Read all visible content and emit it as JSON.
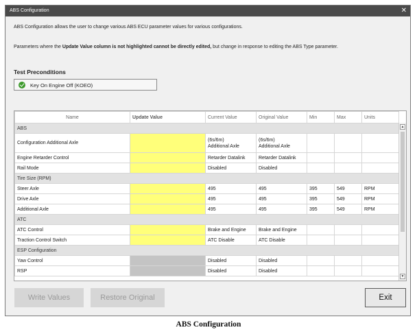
{
  "window": {
    "title": "ABS Configuration",
    "close_glyph": "✕"
  },
  "description": {
    "line1": "ABS Configuration allows the user to change various ABS ECU parameter values for various configurations.",
    "line2_prefix": "Parameters where the ",
    "line2_bold": "Update Value column is not highlighted cannot be directly edited,",
    "line2_suffix": " but change in response to editing the ABS Type parameter."
  },
  "preconditions": {
    "title": "Test Preconditions",
    "item_label": "Key On Engine Off (KOEO)",
    "item_icon": "check-circle-icon",
    "item_status_color": "#3d9a2c"
  },
  "table": {
    "headers": [
      "Name",
      "Update Value",
      "Current Value",
      "Original Value",
      "Min",
      "Max",
      "Units"
    ],
    "rows": [
      {
        "type": "group",
        "name": "ABS"
      },
      {
        "type": "param",
        "name": "Configuration Additional Axle",
        "update": "editable",
        "current": "(6s/6m)\nAdditional Axle",
        "original": "(6s/6m)\nAdditional Axle",
        "min": "",
        "max": "",
        "units": ""
      },
      {
        "type": "param",
        "name": "Engine Retarder Control",
        "update": "editable",
        "current": "Retarder Datalink",
        "original": "Retarder Datalink",
        "min": "",
        "max": "",
        "units": ""
      },
      {
        "type": "param",
        "name": "Rail Mode",
        "update": "editable",
        "current": "Disabled",
        "original": "Disabled",
        "min": "",
        "max": "",
        "units": ""
      },
      {
        "type": "group",
        "name": "Tire Size (RPM)"
      },
      {
        "type": "param",
        "name": "Steer Axle",
        "update": "editable",
        "current": "495",
        "original": "495",
        "min": "395",
        "max": "549",
        "units": "RPM"
      },
      {
        "type": "param",
        "name": "Drive Axle",
        "update": "editable",
        "current": "495",
        "original": "495",
        "min": "395",
        "max": "549",
        "units": "RPM"
      },
      {
        "type": "param",
        "name": "Additional Axle",
        "update": "editable",
        "current": "495",
        "original": "495",
        "min": "395",
        "max": "549",
        "units": "RPM"
      },
      {
        "type": "group",
        "name": "ATC"
      },
      {
        "type": "param",
        "name": "ATC Control",
        "update": "editable",
        "current": "Brake and Engine",
        "original": "Brake and Engine",
        "min": "",
        "max": "",
        "units": ""
      },
      {
        "type": "param",
        "name": "Traction Control Switch",
        "update": "editable",
        "current": "ATC Disable",
        "original": "ATC Disable",
        "min": "",
        "max": "",
        "units": ""
      },
      {
        "type": "group",
        "name": "ESP Configuration"
      },
      {
        "type": "param",
        "name": "Yaw Control",
        "update": "disabled",
        "current": "Disabled",
        "original": "Disabled",
        "min": "",
        "max": "",
        "units": ""
      },
      {
        "type": "param",
        "name": "RSP",
        "update": "disabled",
        "current": "Disabled",
        "original": "Disabled",
        "min": "",
        "max": "",
        "units": ""
      }
    ]
  },
  "buttons": {
    "write": "Write Values",
    "restore": "Restore Original",
    "exit": "Exit"
  },
  "caption": "ABS Configuration",
  "colors": {
    "editable_cell": "#ffff7a",
    "disabled_cell": "#c4c4c4",
    "group_row": "#e2e2e2",
    "titlebar": "#4a4a4a"
  }
}
